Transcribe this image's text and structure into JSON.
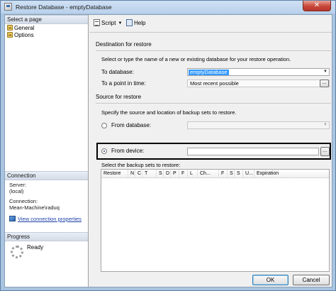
{
  "window": {
    "title": "Restore Database - emptyDatabase",
    "close_glyph": "✕"
  },
  "left_pane": {
    "select_page_header": "Select a page",
    "pages": [
      {
        "label": "General",
        "icon": "page-icon"
      },
      {
        "label": "Options",
        "icon": "page-icon"
      }
    ],
    "connection_header": "Connection",
    "server_label": "Server:",
    "server_value": "(local)",
    "connection_label": "Connection:",
    "connection_value": "Mean-Machine\\raduq",
    "view_connection_properties": "View connection properties",
    "progress_header": "Progress",
    "progress_status": "Ready"
  },
  "toolbar": {
    "script_label": "Script",
    "script_dropdown_glyph": "▼",
    "help_label": "Help"
  },
  "destination": {
    "section_title": "Destination for restore",
    "description": "Select or type the name of a new or existing database for your restore operation.",
    "to_database_label": "To database:",
    "to_database_value": "emptyDatabase",
    "point_in_time_label": "To a point in time:",
    "point_in_time_value": "Most recent possible"
  },
  "source": {
    "section_title": "Source for restore",
    "description": "Specify the source and location of backup sets to restore.",
    "from_database_label": "From database:",
    "from_device_label": "From device:",
    "browse_label": "...",
    "selected_option": "from_device"
  },
  "backup_sets": {
    "label": "Select the backup sets to restore:",
    "columns": [
      "Restore",
      "N",
      "C",
      "T",
      "S",
      "D",
      "P",
      "F",
      "L",
      "Ch...",
      "F",
      "S",
      "S",
      "U...",
      "Expiration"
    ],
    "rows": []
  },
  "footer": {
    "ok_label": "OK",
    "cancel_label": "Cancel"
  },
  "colors": {
    "title_bar": "#b9d1ec",
    "accent_selection": "#3399ff",
    "link": "#1b3fa8",
    "close_button": "#c7473a"
  },
  "glyphs": {
    "combo_arrow": "▼"
  }
}
